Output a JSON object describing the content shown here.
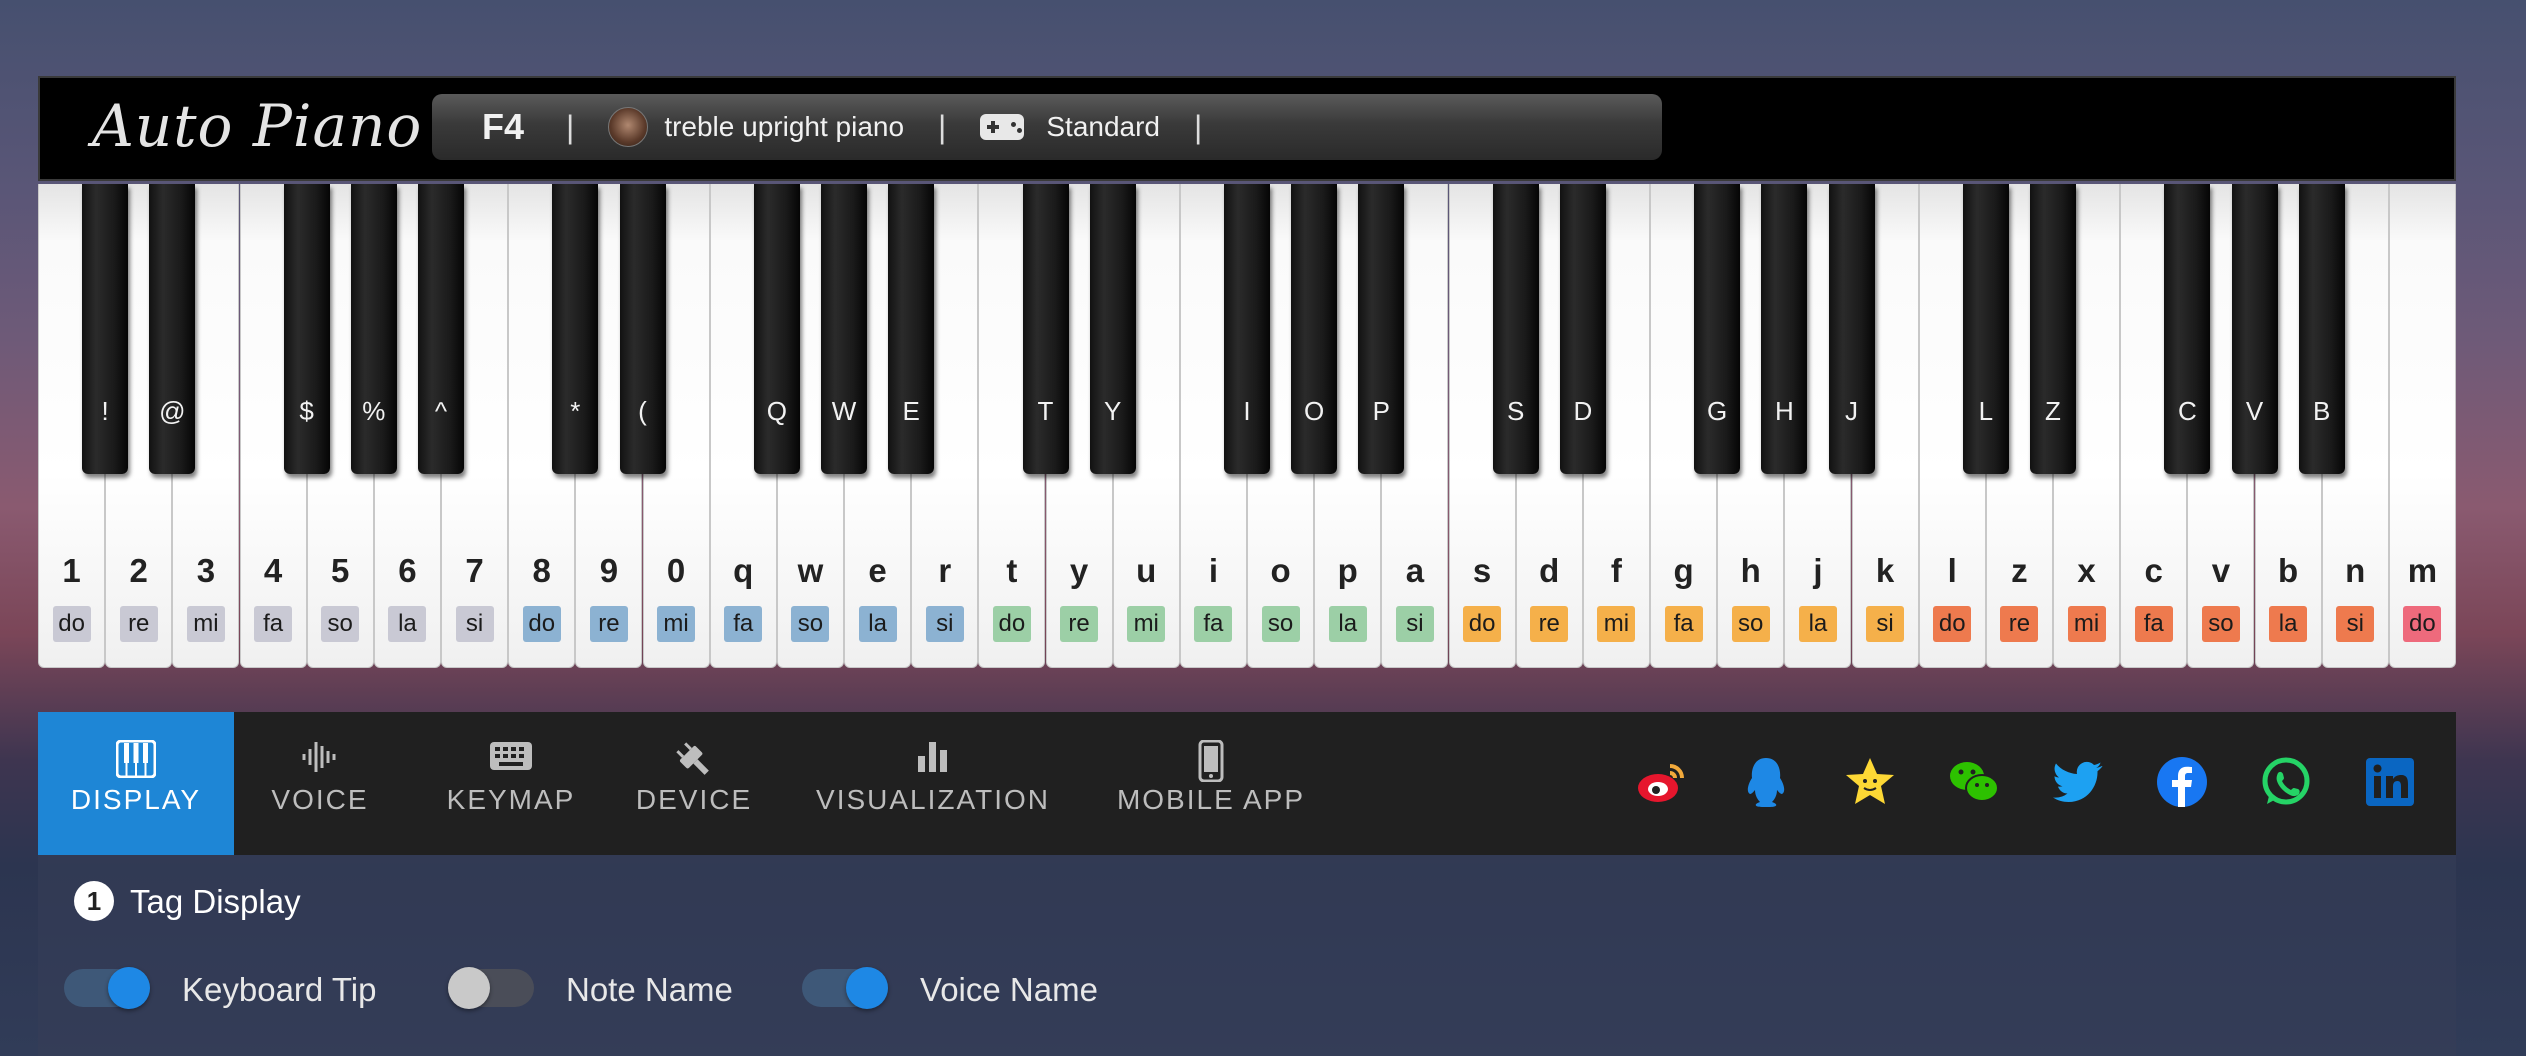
{
  "app": {
    "logo": "Auto Piano"
  },
  "status": {
    "note": "F4",
    "separator": "|",
    "instrument": "treble upright piano",
    "mode": "Standard"
  },
  "keyboard": {
    "white_keys": [
      {
        "key": "1",
        "solfege": "do",
        "color": "#c9c9d4"
      },
      {
        "key": "2",
        "solfege": "re",
        "color": "#c9c9d4"
      },
      {
        "key": "3",
        "solfege": "mi",
        "color": "#c9c9d4"
      },
      {
        "key": "4",
        "solfege": "fa",
        "color": "#c9c9d4"
      },
      {
        "key": "5",
        "solfege": "so",
        "color": "#c9c9d4"
      },
      {
        "key": "6",
        "solfege": "la",
        "color": "#c9c9d4"
      },
      {
        "key": "7",
        "solfege": "si",
        "color": "#c9c9d4"
      },
      {
        "key": "8",
        "solfege": "do",
        "color": "#8cb2d2"
      },
      {
        "key": "9",
        "solfege": "re",
        "color": "#8cb2d2"
      },
      {
        "key": "0",
        "solfege": "mi",
        "color": "#8cb2d2"
      },
      {
        "key": "q",
        "solfege": "fa",
        "color": "#8cb2d2"
      },
      {
        "key": "w",
        "solfege": "so",
        "color": "#8cb2d2"
      },
      {
        "key": "e",
        "solfege": "la",
        "color": "#8cb2d2"
      },
      {
        "key": "r",
        "solfege": "si",
        "color": "#8cb2d2"
      },
      {
        "key": "t",
        "solfege": "do",
        "color": "#9ccfa6"
      },
      {
        "key": "y",
        "solfege": "re",
        "color": "#9ccfa6"
      },
      {
        "key": "u",
        "solfege": "mi",
        "color": "#9ccfa6"
      },
      {
        "key": "i",
        "solfege": "fa",
        "color": "#9ccfa6"
      },
      {
        "key": "o",
        "solfege": "so",
        "color": "#9ccfa6"
      },
      {
        "key": "p",
        "solfege": "la",
        "color": "#9ccfa6"
      },
      {
        "key": "a",
        "solfege": "si",
        "color": "#9ccfa6"
      },
      {
        "key": "s",
        "solfege": "do",
        "color": "#f5b04a"
      },
      {
        "key": "d",
        "solfege": "re",
        "color": "#f5b04a"
      },
      {
        "key": "f",
        "solfege": "mi",
        "color": "#f5b04a"
      },
      {
        "key": "g",
        "solfege": "fa",
        "color": "#f5b04a"
      },
      {
        "key": "h",
        "solfege": "so",
        "color": "#f5b04a"
      },
      {
        "key": "j",
        "solfege": "la",
        "color": "#f5b04a"
      },
      {
        "key": "k",
        "solfege": "si",
        "color": "#f5b04a"
      },
      {
        "key": "l",
        "solfege": "do",
        "color": "#ee7a4e"
      },
      {
        "key": "z",
        "solfege": "re",
        "color": "#ee7a4e"
      },
      {
        "key": "x",
        "solfege": "mi",
        "color": "#ee7a4e"
      },
      {
        "key": "c",
        "solfege": "fa",
        "color": "#ee7a4e"
      },
      {
        "key": "v",
        "solfege": "so",
        "color": "#ee7a4e"
      },
      {
        "key": "b",
        "solfege": "la",
        "color": "#ee7a4e"
      },
      {
        "key": "n",
        "solfege": "si",
        "color": "#ee7a4e"
      },
      {
        "key": "m",
        "solfege": "do",
        "color": "#ee6a7c"
      }
    ],
    "black_keys": [
      {
        "key": "!",
        "after": 0
      },
      {
        "key": "@",
        "after": 1
      },
      {
        "key": "$",
        "after": 3
      },
      {
        "key": "%",
        "after": 4
      },
      {
        "key": "^",
        "after": 5
      },
      {
        "key": "*",
        "after": 7
      },
      {
        "key": "(",
        "after": 8
      },
      {
        "key": "Q",
        "after": 10
      },
      {
        "key": "W",
        "after": 11
      },
      {
        "key": "E",
        "after": 12
      },
      {
        "key": "T",
        "after": 14
      },
      {
        "key": "Y",
        "after": 15
      },
      {
        "key": "I",
        "after": 17
      },
      {
        "key": "O",
        "after": 18
      },
      {
        "key": "P",
        "after": 19
      },
      {
        "key": "S",
        "after": 21
      },
      {
        "key": "D",
        "after": 22
      },
      {
        "key": "G",
        "after": 24
      },
      {
        "key": "H",
        "after": 25
      },
      {
        "key": "J",
        "after": 26
      },
      {
        "key": "L",
        "after": 28
      },
      {
        "key": "Z",
        "after": 29
      },
      {
        "key": "C",
        "after": 31
      },
      {
        "key": "V",
        "after": 32
      },
      {
        "key": "B",
        "after": 33
      }
    ]
  },
  "tabs": [
    {
      "label": "DISPLAY",
      "icon": "piano-keys-icon",
      "active": true
    },
    {
      "label": "VOICE",
      "icon": "waveform-icon",
      "active": false
    },
    {
      "label": "KEYMAP",
      "icon": "keyboard-icon",
      "active": false
    },
    {
      "label": "DEVICE",
      "icon": "plug-icon",
      "active": false
    },
    {
      "label": "VISUALIZATION",
      "icon": "bar-chart-icon",
      "active": false
    },
    {
      "label": "MOBILE APP",
      "icon": "phone-icon",
      "active": false
    }
  ],
  "social": [
    {
      "name": "weibo-icon",
      "color": "#e6162d"
    },
    {
      "name": "qq-icon",
      "color": "#1e88e5"
    },
    {
      "name": "qzone-icon",
      "color": "#fdd835"
    },
    {
      "name": "wechat-icon",
      "color": "#2dc100"
    },
    {
      "name": "twitter-icon",
      "color": "#1da1f2"
    },
    {
      "name": "facebook-icon",
      "color": "#1877f2"
    },
    {
      "name": "whatsapp-icon",
      "color": "#25d366"
    },
    {
      "name": "linkedin-icon",
      "color": "#0a66c2"
    }
  ],
  "settings": {
    "section_number": "1",
    "section_title": "Tag Display",
    "toggles": [
      {
        "label": "Keyboard Tip",
        "on": true
      },
      {
        "label": "Note Name",
        "on": false
      },
      {
        "label": "Voice Name",
        "on": true
      }
    ]
  }
}
